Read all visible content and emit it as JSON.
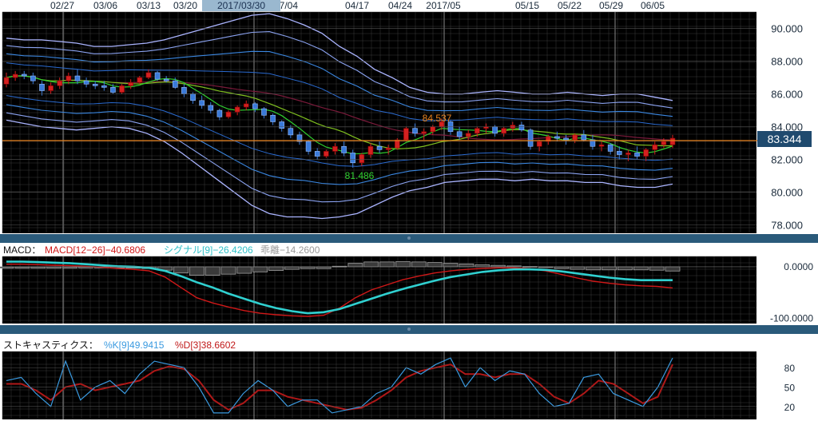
{
  "date_axis": {
    "labels": [
      "02/27",
      "03/06",
      "03/13",
      "03/20",
      "07/04",
      "04/17",
      "04/24",
      "2017/05",
      "05/15",
      "05/22",
      "05/29",
      "06/05"
    ],
    "cursor_label": "2017/03/30"
  },
  "main_panel": {
    "y_ticks": [
      "90.000",
      "88.000",
      "86.000",
      "84.000",
      "82.000",
      "80.000",
      "78.000"
    ],
    "current_price": "83.344",
    "high_annotation": "84.537",
    "low_annotation": "81.486"
  },
  "macd_panel": {
    "label": "MACD：",
    "macd_text": "MACD[12−26]−40.6806",
    "signal_text": "シグナル[9]−26.4206",
    "hist_text": "乖離−14.2600",
    "y_ticks": [
      "0.0000",
      "-100.0000"
    ]
  },
  "stoch_panel": {
    "label": "ストキャスティクス：",
    "k_text": "%K[9]49.9415",
    "d_text": "%D[3]38.6602",
    "y_ticks": [
      "80",
      "50",
      "20"
    ]
  },
  "colors": {
    "background": "#000000",
    "grid": "#3a3a3a",
    "up": "#d42020",
    "down": "#3a7ad9",
    "orange": "#e8821e",
    "green": "#2fcf2f",
    "cyan": "#30d0d0",
    "red": "#d01818",
    "separator": "#2a5a7a"
  },
  "chart_data": [
    {
      "type": "candlestick",
      "title": "",
      "x": [
        "02/21",
        "02/22",
        "02/23",
        "02/24",
        "02/27",
        "02/28",
        "03/01",
        "03/02",
        "03/03",
        "03/06",
        "03/07",
        "03/08",
        "03/09",
        "03/10",
        "03/13",
        "03/14",
        "03/15",
        "03/16",
        "03/17",
        "03/20",
        "03/21",
        "03/22",
        "03/23",
        "03/24",
        "03/27",
        "03/28",
        "03/29",
        "03/30",
        "03/31",
        "04/03",
        "04/04",
        "04/05",
        "04/06",
        "04/07",
        "04/10",
        "04/11",
        "04/12",
        "04/13",
        "04/14",
        "04/17",
        "04/18",
        "04/19",
        "04/20",
        "04/21",
        "04/24",
        "04/25",
        "04/26",
        "04/27",
        "04/28",
        "05/01",
        "05/02",
        "05/03",
        "05/04",
        "05/05",
        "05/08",
        "05/09",
        "05/10",
        "05/11",
        "05/12",
        "05/15",
        "05/16",
        "05/17",
        "05/18",
        "05/19",
        "05/22",
        "05/23",
        "05/24",
        "05/25",
        "05/26",
        "05/29",
        "05/30",
        "05/31",
        "06/01",
        "06/02",
        "06/05",
        "06/06"
      ],
      "candles": [
        [
          86.6,
          87.3,
          86.4,
          87.0
        ],
        [
          87.0,
          87.4,
          86.8,
          87.2
        ],
        [
          87.2,
          87.4,
          86.9,
          87.1
        ],
        [
          87.1,
          87.3,
          86.6,
          86.8
        ],
        [
          86.6,
          86.8,
          85.9,
          86.2
        ],
        [
          86.2,
          86.7,
          86.0,
          86.5
        ],
        [
          86.5,
          87.0,
          86.3,
          86.8
        ],
        [
          86.8,
          87.3,
          86.6,
          87.1
        ],
        [
          87.1,
          87.5,
          86.6,
          86.8
        ],
        [
          86.8,
          87.0,
          86.4,
          86.6
        ],
        [
          86.6,
          86.8,
          86.3,
          86.5
        ],
        [
          86.5,
          86.8,
          86.2,
          86.4
        ],
        [
          86.4,
          86.6,
          86.0,
          86.1
        ],
        [
          86.1,
          86.6,
          86.0,
          86.5
        ],
        [
          86.5,
          86.9,
          86.3,
          86.7
        ],
        [
          86.7,
          87.1,
          86.6,
          87.0
        ],
        [
          87.0,
          87.5,
          86.9,
          87.3
        ],
        [
          87.3,
          87.4,
          86.8,
          86.9
        ],
        [
          86.9,
          87.1,
          86.7,
          86.8
        ],
        [
          86.8,
          87.0,
          86.3,
          86.4
        ],
        [
          86.4,
          86.6,
          85.8,
          86.0
        ],
        [
          86.0,
          86.1,
          85.4,
          85.6
        ],
        [
          85.6,
          85.9,
          85.1,
          85.3
        ],
        [
          85.3,
          85.5,
          84.8,
          85.0
        ],
        [
          85.0,
          85.1,
          84.4,
          84.6
        ],
        [
          84.6,
          85.0,
          84.5,
          84.9
        ],
        [
          84.9,
          85.3,
          84.7,
          85.2
        ],
        [
          85.2,
          85.6,
          85.0,
          85.4
        ],
        [
          85.4,
          85.5,
          84.9,
          85.1
        ],
        [
          85.1,
          85.2,
          84.5,
          84.7
        ],
        [
          84.7,
          84.8,
          84.1,
          84.3
        ],
        [
          84.3,
          84.4,
          83.7,
          83.9
        ],
        [
          83.9,
          84.1,
          83.3,
          83.5
        ],
        [
          83.5,
          83.7,
          82.9,
          83.1
        ],
        [
          83.1,
          83.2,
          82.3,
          82.5
        ],
        [
          82.5,
          82.7,
          82.0,
          82.2
        ],
        [
          82.2,
          82.6,
          82.1,
          82.5
        ],
        [
          82.5,
          83.0,
          82.3,
          82.8
        ],
        [
          82.8,
          83.1,
          82.2,
          82.4
        ],
        [
          82.4,
          82.6,
          81.5,
          81.8
        ],
        [
          81.8,
          82.4,
          81.6,
          82.3
        ],
        [
          82.3,
          83.0,
          82.1,
          82.8
        ],
        [
          82.8,
          83.1,
          82.4,
          82.6
        ],
        [
          82.6,
          82.9,
          82.3,
          82.7
        ],
        [
          82.7,
          83.3,
          82.6,
          83.2
        ],
        [
          83.2,
          84.0,
          83.1,
          83.9
        ],
        [
          83.9,
          84.2,
          83.4,
          83.6
        ],
        [
          83.6,
          83.9,
          83.2,
          83.7
        ],
        [
          83.7,
          84.1,
          83.5,
          84.0
        ],
        [
          84.0,
          84.5,
          83.8,
          84.3
        ],
        [
          84.3,
          84.4,
          83.5,
          83.7
        ],
        [
          83.7,
          84.0,
          83.2,
          83.4
        ],
        [
          83.4,
          83.8,
          83.2,
          83.6
        ],
        [
          83.6,
          84.0,
          83.4,
          83.9
        ],
        [
          83.9,
          84.2,
          83.6,
          84.0
        ],
        [
          84.0,
          84.1,
          83.4,
          83.6
        ],
        [
          83.6,
          84.0,
          83.4,
          83.9
        ],
        [
          83.9,
          84.3,
          83.7,
          84.1
        ],
        [
          84.1,
          84.3,
          83.7,
          83.8
        ],
        [
          83.8,
          83.9,
          82.6,
          82.8
        ],
        [
          82.8,
          83.2,
          82.5,
          83.1
        ],
        [
          83.1,
          83.5,
          82.9,
          83.4
        ],
        [
          83.4,
          83.7,
          83.1,
          83.3
        ],
        [
          83.3,
          83.5,
          82.9,
          83.2
        ],
        [
          83.2,
          83.6,
          83.0,
          83.5
        ],
        [
          83.5,
          83.8,
          83.1,
          83.2
        ],
        [
          83.2,
          83.5,
          82.6,
          82.8
        ],
        [
          82.8,
          83.1,
          82.5,
          82.9
        ],
        [
          82.9,
          83.0,
          82.3,
          82.5
        ],
        [
          82.5,
          82.8,
          82.0,
          82.3
        ],
        [
          82.3,
          82.6,
          81.9,
          82.4
        ],
        [
          82.4,
          82.8,
          82.0,
          82.2
        ],
        [
          82.2,
          82.7,
          81.9,
          82.6
        ],
        [
          82.6,
          83.1,
          82.3,
          82.9
        ],
        [
          82.9,
          83.3,
          82.7,
          83.1
        ],
        [
          82.9,
          83.5,
          82.7,
          83.3
        ]
      ],
      "moving_averages": [
        "orange",
        "green",
        "darkred"
      ],
      "bands": [
        {
          "name": "outer",
          "upper": [
            89.4,
            89.3,
            89.3,
            89.2,
            89.1,
            88.9,
            88.9,
            89.0,
            89.1,
            89.3,
            89.6,
            89.9,
            90.2,
            90.5,
            90.8,
            90.9,
            90.6,
            90.2,
            89.7,
            88.9,
            88.3,
            87.5,
            87.0,
            86.4,
            86.1,
            86.0,
            86.0,
            86.1,
            86.2,
            86.1,
            86.0,
            86.0,
            86.1,
            86.0,
            85.9,
            86.0,
            86.0,
            85.8,
            85.6
          ],
          "lower": [
            84.4,
            84.2,
            84.0,
            83.9,
            83.8,
            83.9,
            84.0,
            83.9,
            83.6,
            83.1,
            82.4,
            81.6,
            80.8,
            80.0,
            79.2,
            78.7,
            78.5,
            78.5,
            78.4,
            78.5,
            78.7,
            79.2,
            79.7,
            80.1,
            80.3,
            80.6,
            80.7,
            80.8,
            80.8,
            80.7,
            80.8,
            80.7,
            80.7,
            80.6,
            80.6,
            80.4,
            80.3,
            80.3,
            80.5
          ]
        }
      ],
      "ylim": [
        77.5,
        91.0
      ],
      "last_price": 83.344
    },
    {
      "type": "line",
      "title": "MACD",
      "series": [
        {
          "name": "MACD[12−26]",
          "values": [
            5,
            5,
            4,
            3,
            2,
            1,
            -1,
            -3,
            -5,
            -8,
            -20,
            -40,
            -60,
            -70,
            -78,
            -85,
            -90,
            -93,
            -95,
            -96,
            -94,
            -80,
            -60,
            -45,
            -35,
            -25,
            -18,
            -12,
            -8,
            -5,
            -3,
            -2,
            -2,
            -4,
            -8,
            -15,
            -22,
            -28,
            -32,
            -35,
            -37,
            -38,
            -41
          ]
        },
        {
          "name": "シグナル[9]",
          "values": [
            10,
            10,
            9,
            8,
            7,
            5,
            3,
            1,
            0,
            -2,
            -8,
            -18,
            -30,
            -40,
            -52,
            -62,
            -72,
            -80,
            -86,
            -90,
            -88,
            -82,
            -72,
            -62,
            -52,
            -43,
            -35,
            -27,
            -20,
            -15,
            -10,
            -7,
            -5,
            -5,
            -6,
            -9,
            -13,
            -17,
            -21,
            -24,
            -26,
            -26,
            -26
          ]
        }
      ],
      "ylim": [
        -110,
        20
      ]
    },
    {
      "type": "line",
      "title": "ストキャスティクス",
      "series": [
        {
          "name": "%K[9]",
          "values": [
            60,
            65,
            40,
            20,
            90,
            30,
            50,
            60,
            40,
            70,
            90,
            85,
            80,
            50,
            10,
            10,
            40,
            60,
            45,
            20,
            30,
            30,
            10,
            15,
            20,
            40,
            50,
            80,
            70,
            85,
            95,
            50,
            80,
            60,
            75,
            70,
            40,
            20,
            25,
            65,
            70,
            40,
            30,
            20,
            50,
            95
          ]
        },
        {
          "name": "%D[3]",
          "values": [
            55,
            55,
            45,
            30,
            50,
            55,
            45,
            50,
            55,
            60,
            75,
            82,
            78,
            60,
            30,
            15,
            25,
            45,
            45,
            35,
            30,
            25,
            20,
            15,
            18,
            30,
            45,
            65,
            75,
            80,
            85,
            70,
            70,
            65,
            70,
            70,
            55,
            35,
            25,
            40,
            60,
            55,
            40,
            25,
            35,
            85
          ]
        }
      ],
      "ylim": [
        0,
        105
      ]
    }
  ]
}
